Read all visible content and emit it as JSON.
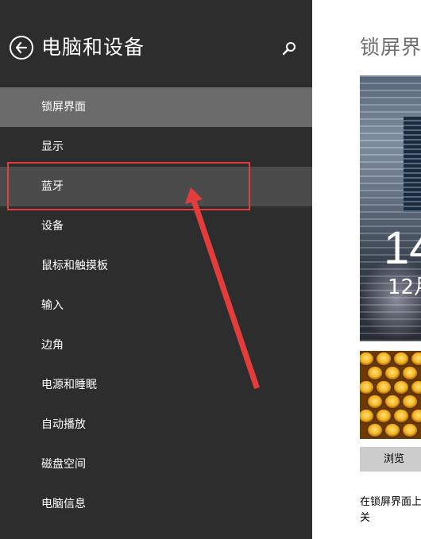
{
  "sidebar": {
    "title": "电脑和设备",
    "items": [
      {
        "label": "锁屏界面",
        "state": "selected"
      },
      {
        "label": "显示",
        "state": "normal"
      },
      {
        "label": "蓝牙",
        "state": "hover"
      },
      {
        "label": "设备",
        "state": "normal"
      },
      {
        "label": "鼠标和触摸板",
        "state": "normal"
      },
      {
        "label": "输入",
        "state": "normal"
      },
      {
        "label": "边角",
        "state": "normal"
      },
      {
        "label": "电源和睡眠",
        "state": "normal"
      },
      {
        "label": "自动播放",
        "state": "normal"
      },
      {
        "label": "磁盘空间",
        "state": "normal"
      },
      {
        "label": "电脑信息",
        "state": "normal"
      }
    ]
  },
  "content": {
    "title": "锁屏界",
    "preview": {
      "time": "14",
      "date": "12月"
    },
    "browse_label": "浏览",
    "lock_desc_line1": "在锁屏界面上",
    "lock_desc_line2": "关"
  },
  "colors": {
    "sidebar_bg": "#2d2d2d",
    "selected_bg": "#6b6b6b",
    "hover_bg": "#4b4b4b",
    "annotation_red": "#e23c3c",
    "browse_bg": "#cccccc"
  },
  "icons": {
    "back": "back-arrow-circle-icon",
    "search": "search-icon"
  }
}
